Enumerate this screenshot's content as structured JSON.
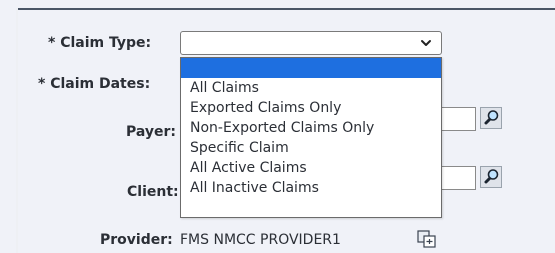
{
  "form": {
    "claim_type_label": "* Claim Type:",
    "claim_dates_label": "* Claim Dates:",
    "payer_label": "Payer:",
    "client_label": "Client:",
    "provider_label": "Provider:",
    "provider_value": "FMS NMCC PROVIDER1",
    "claim_type_value": ""
  },
  "dropdown": {
    "options": [
      {
        "label": ""
      },
      {
        "label": "All Claims"
      },
      {
        "label": "Exported Claims Only"
      },
      {
        "label": "Non-Exported Claims Only"
      },
      {
        "label": "Specific Claim"
      },
      {
        "label": "All Active Claims"
      },
      {
        "label": "All Inactive Claims"
      }
    ],
    "highlight_color": "#1e6fe0"
  },
  "icons": {
    "select_chevron": "chevron-down-icon",
    "payer_lookup": "magnifier-icon",
    "client_lookup": "magnifier-icon",
    "provider_action": "copy-icon"
  }
}
